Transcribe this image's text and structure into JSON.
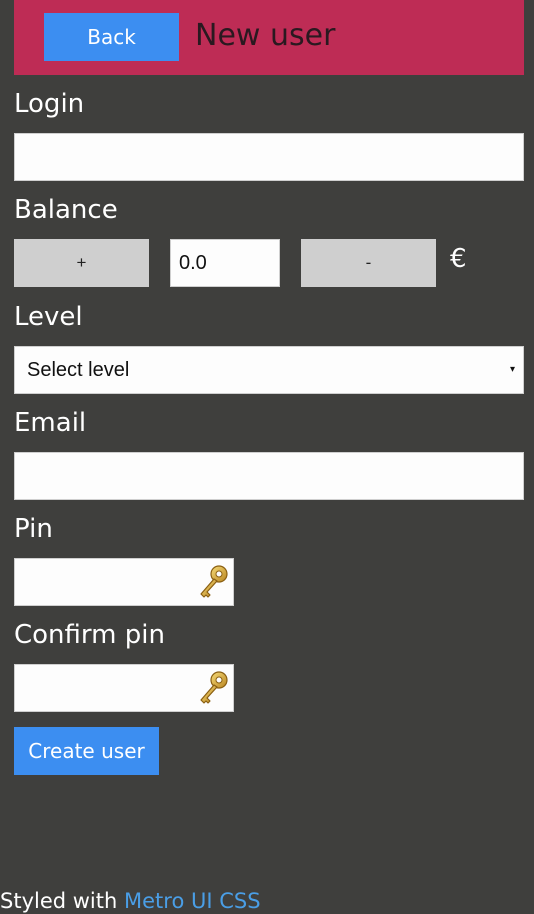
{
  "header": {
    "back_label": "Back",
    "title": "New user",
    "background_color": "#be2c55",
    "back_button_color": "#3c8ef1"
  },
  "form": {
    "login": {
      "label": "Login",
      "value": ""
    },
    "balance": {
      "label": "Balance",
      "increment_label": "+",
      "value": "0.0",
      "decrement_label": "-",
      "currency": "€"
    },
    "level": {
      "label": "Level",
      "selected": "Select level",
      "arrow": "▾"
    },
    "email": {
      "label": "Email",
      "value": ""
    },
    "pin": {
      "label": "Pin",
      "value": "",
      "icon": "key-icon"
    },
    "confirm_pin": {
      "label": "Confirm pin",
      "value": "",
      "icon": "key-icon"
    },
    "submit_label": "Create user"
  },
  "footer": {
    "prefix": "Styled with",
    "link_text": "Metro UI CSS"
  }
}
